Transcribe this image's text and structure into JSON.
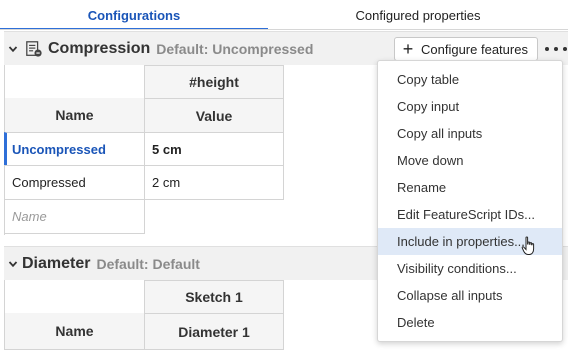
{
  "tabs": [
    {
      "label": "Configurations"
    },
    {
      "label": "Configured properties"
    }
  ],
  "section1": {
    "title": "Compression",
    "default_label": "Default: Uncompressed",
    "configure_button": "Configure features",
    "table": {
      "param_header": "#height",
      "name_header": "Name",
      "value_header": "Value",
      "rows": [
        {
          "name": "Uncompressed",
          "value": "5 cm"
        },
        {
          "name": "Compressed",
          "value": "2 cm"
        }
      ],
      "name_placeholder": "Name"
    }
  },
  "section2": {
    "title": "Diameter",
    "default_label": "Default: Default",
    "table": {
      "param_header": "Sketch 1",
      "name_header": "Name",
      "value_header": "Diameter 1"
    }
  },
  "menu": {
    "items": [
      "Copy table",
      "Copy input",
      "Copy all inputs",
      "Move down",
      "Rename",
      "Edit FeatureScript IDs...",
      "Include in properties...",
      "Visibility conditions...",
      "Collapse all inputs",
      "Delete"
    ],
    "highlighted_index": 6
  },
  "colors": {
    "accent": "#2e6fd8",
    "active_tab_text": "#1a55b8",
    "menu_highlight": "#dfe9f7"
  }
}
